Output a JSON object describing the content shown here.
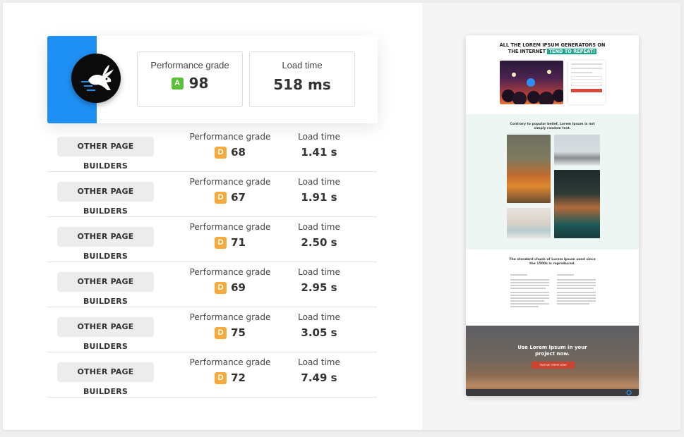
{
  "hero": {
    "performance_label": "Performance grade",
    "performance_grade": "A",
    "performance_score": "98",
    "load_label": "Load time",
    "load_value": "518 ms"
  },
  "rows": [
    {
      "tag": "OTHER PAGE BUILDERS",
      "grade_label": "Performance grade",
      "grade": "D",
      "score": "68",
      "time_label": "Load time",
      "time": "1.41 s"
    },
    {
      "tag": "OTHER PAGE BUILDERS",
      "grade_label": "Performance grade",
      "grade": "D",
      "score": "67",
      "time_label": "Load time",
      "time": "1.91 s"
    },
    {
      "tag": "OTHER PAGE BUILDERS",
      "grade_label": "Performance grade",
      "grade": "D",
      "score": "71",
      "time_label": "Load time",
      "time": "2.50 s"
    },
    {
      "tag": "OTHER PAGE BUILDERS",
      "grade_label": "Performance grade",
      "grade": "D",
      "score": "69",
      "time_label": "Load time",
      "time": "2.95 s"
    },
    {
      "tag": "OTHER PAGE BUILDERS",
      "grade_label": "Performance grade",
      "grade": "D",
      "score": "75",
      "time_label": "Load time",
      "time": "3.05 s"
    },
    {
      "tag": "OTHER PAGE BUILDERS",
      "grade_label": "Performance grade",
      "grade": "D",
      "score": "72",
      "time_label": "Load time",
      "time": "7.49 s"
    }
  ],
  "preview": {
    "headline_1": "ALL THE LOREM IPSUM GENERATORS ON",
    "headline_2": "THE INTERNET",
    "headline_highlight": "TEND TO REPEAT!",
    "section2_text_1": "Contrary to popular belief, Lorem Ipsum is not",
    "section2_text_2": "simply random text.",
    "section3_text_1": "The standard chunk of Lorem Ipsum used since",
    "section3_text_2": "the 1500s is reproduced.",
    "cta_1": "Use Lorem Ipsum in your",
    "cta_2": "project now.",
    "cta_button": "TAKE ME THERE NOW!"
  },
  "colors": {
    "brand_blue": "#1e90f3",
    "grade_a": "#5cbf3a",
    "grade_d": "#f4aa3c",
    "highlight": "#1aa58f",
    "cta_red": "#c9432f"
  },
  "icons": {
    "logo": "rabbit-logo-icon"
  }
}
